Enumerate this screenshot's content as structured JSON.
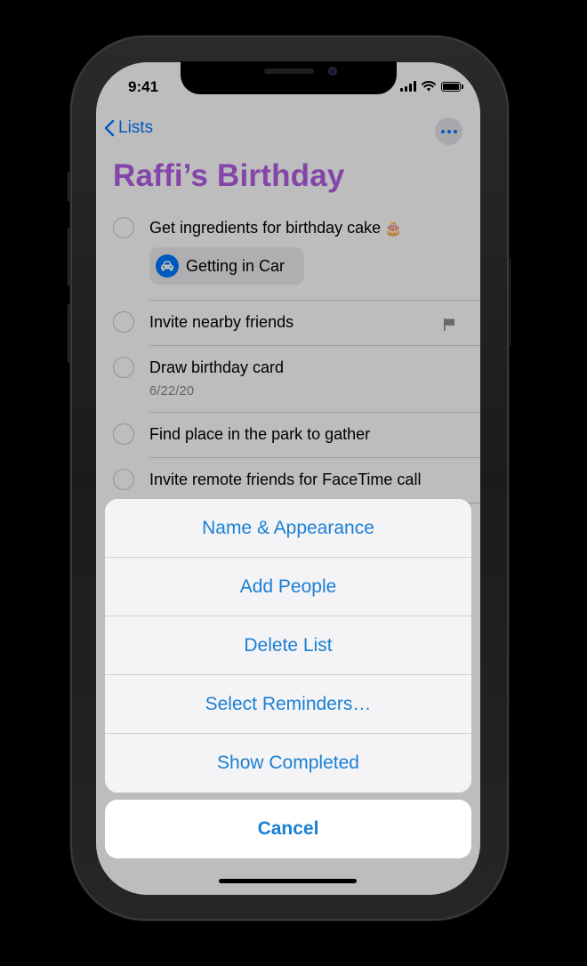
{
  "status_bar": {
    "time": "9:41"
  },
  "nav": {
    "back_label": "Lists",
    "back_icon": "chevron-left-icon",
    "more_icon": "ellipsis-icon"
  },
  "list": {
    "title": "Raffi’s Birthday",
    "title_color": "#b15ee4"
  },
  "reminders": [
    {
      "title": "Get ingredients for birthday cake",
      "emoji": "🎂",
      "location_chip": "Getting in Car"
    },
    {
      "title": "Invite nearby friends",
      "flagged": true
    },
    {
      "title": "Draw birthday card",
      "date": "6/22/20"
    },
    {
      "title": "Find place in the park to gather"
    },
    {
      "title": "Invite remote friends for FaceTime call"
    }
  ],
  "action_sheet": {
    "items": [
      "Name & Appearance",
      "Add People",
      "Delete List",
      "Select Reminders…",
      "Show Completed"
    ],
    "cancel": "Cancel",
    "accent_color": "#1a7fd4"
  }
}
